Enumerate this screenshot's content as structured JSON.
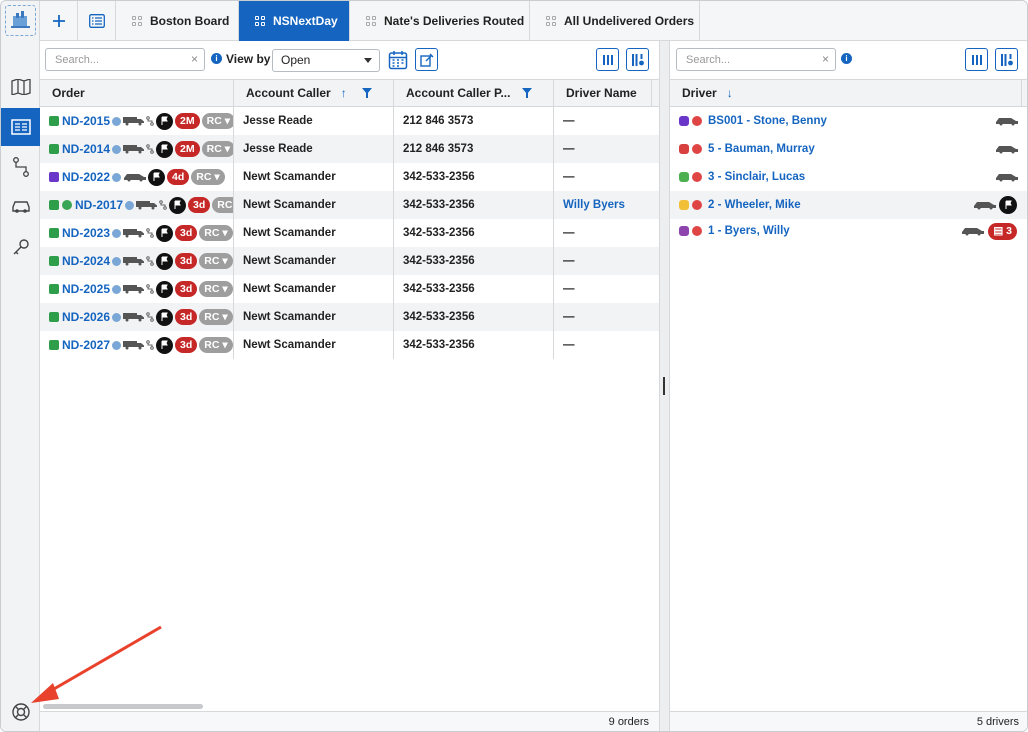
{
  "tabs": [
    {
      "label": "Boston Board",
      "active": false
    },
    {
      "label": "NSNextDay",
      "active": true
    },
    {
      "label": "Nate's Deliveries Routed",
      "active": false
    },
    {
      "label": "All Undelivered Orders",
      "active": false
    }
  ],
  "orders_panel": {
    "search_placeholder": "Search...",
    "view_by_label": "View by",
    "view_by_value": "Open",
    "columns": [
      {
        "label": "Order"
      },
      {
        "label": "Account Caller",
        "sort": "↑"
      },
      {
        "label": "Account Caller P..."
      },
      {
        "label": "Driver Name"
      }
    ],
    "rows": [
      {
        "order": "ND-2015",
        "badge": "2M",
        "caller": "Jesse Reade",
        "phone": "212 846 3573",
        "driver": "—",
        "status_color": "#2e9e4a",
        "extra_dot": false,
        "vehicle": "truck"
      },
      {
        "order": "ND-2014",
        "badge": "2M",
        "caller": "Jesse Reade",
        "phone": "212 846 3573",
        "driver": "—",
        "status_color": "#2e9e4a",
        "extra_dot": false,
        "vehicle": "truck"
      },
      {
        "order": "ND-2022",
        "badge": "4d",
        "caller": "Newt Scamander",
        "phone": "342-533-2356",
        "driver": "—",
        "status_color": "#6a35c9",
        "extra_dot": false,
        "vehicle": "car"
      },
      {
        "order": "ND-2017",
        "badge": "3d",
        "caller": "Newt Scamander",
        "phone": "342-533-2356",
        "driver": "Willy Byers",
        "status_color": "#2e9e4a",
        "extra_dot": true,
        "vehicle": "truck"
      },
      {
        "order": "ND-2023",
        "badge": "3d",
        "caller": "Newt Scamander",
        "phone": "342-533-2356",
        "driver": "—",
        "status_color": "#2e9e4a",
        "extra_dot": false,
        "vehicle": "truck"
      },
      {
        "order": "ND-2024",
        "badge": "3d",
        "caller": "Newt Scamander",
        "phone": "342-533-2356",
        "driver": "—",
        "status_color": "#2e9e4a",
        "extra_dot": false,
        "vehicle": "truck"
      },
      {
        "order": "ND-2025",
        "badge": "3d",
        "caller": "Newt Scamander",
        "phone": "342-533-2356",
        "driver": "—",
        "status_color": "#2e9e4a",
        "extra_dot": false,
        "vehicle": "truck"
      },
      {
        "order": "ND-2026",
        "badge": "3d",
        "caller": "Newt Scamander",
        "phone": "342-533-2356",
        "driver": "—",
        "status_color": "#2e9e4a",
        "extra_dot": false,
        "vehicle": "truck"
      },
      {
        "order": "ND-2027",
        "badge": "3d",
        "caller": "Newt Scamander",
        "phone": "342-533-2356",
        "driver": "—",
        "status_color": "#2e9e4a",
        "extra_dot": false,
        "vehicle": "truck"
      }
    ],
    "rc_label": "RC",
    "footer": "9 orders"
  },
  "drivers_panel": {
    "search_placeholder": "Search...",
    "column": "Driver",
    "sort": "↓",
    "rows": [
      {
        "name": "BS001 - Stone, Benny",
        "icon_color": "#6a35c9",
        "flag": false,
        "count": ""
      },
      {
        "name": "5 - Bauman, Murray",
        "icon_color": "#d84040",
        "flag": false,
        "count": ""
      },
      {
        "name": "3 - Sinclair, Lucas",
        "icon_color": "#4caf50",
        "flag": false,
        "count": ""
      },
      {
        "name": "2 - Wheeler, Mike",
        "icon_color": "#f2c037",
        "flag": true,
        "count": ""
      },
      {
        "name": "1 - Byers, Willy",
        "icon_color": "#8e44ad",
        "flag": false,
        "count": "3"
      }
    ],
    "footer": "5 drivers"
  },
  "colors": {
    "accent": "#1565c0",
    "badge_red": "#c62828",
    "annotation_arrow": "#e8412c"
  }
}
